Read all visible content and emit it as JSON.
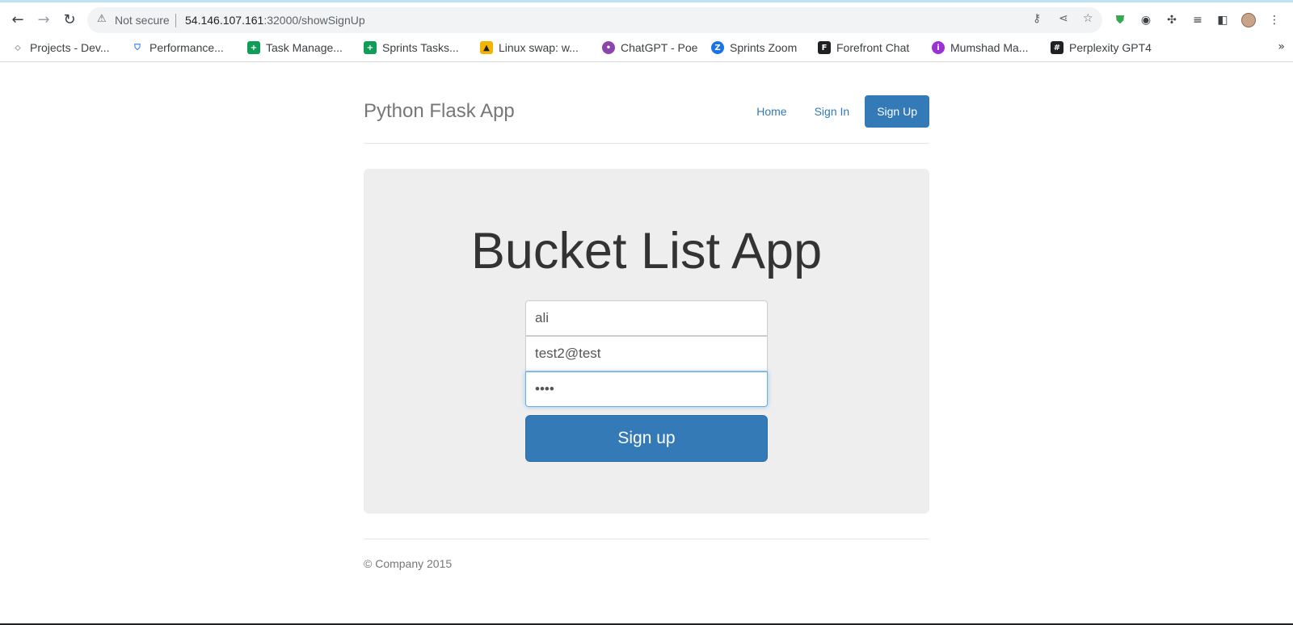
{
  "browser": {
    "omnibox": {
      "security_label": "Not secure",
      "url_host": "54.146.107.161",
      "url_rest": ":32000/showSignUp"
    },
    "bookmarks": [
      {
        "label": "Projects - Dev...",
        "icon_color": "#9aa0a6"
      },
      {
        "label": "Performance...",
        "icon_color": "#1a73e8"
      },
      {
        "label": "Task Manage...",
        "icon_color": "#0f9d58"
      },
      {
        "label": "Sprints Tasks...",
        "icon_color": "#0f9d58"
      },
      {
        "label": "Linux swap: w...",
        "icon_color": "#f4b400"
      },
      {
        "label": "ChatGPT - Poe",
        "icon_color": "#8e44ad"
      },
      {
        "label": "Sprints Zoom",
        "icon_color": "#1a73e8"
      },
      {
        "label": "Forefront Chat",
        "icon_color": "#202124"
      },
      {
        "label": "Mumshad Ma...",
        "icon_color": "#9b30d9"
      },
      {
        "label": "Perplexity GPT4",
        "icon_color": "#202124"
      }
    ],
    "more_bookmarks_glyph": "»"
  },
  "app": {
    "brand": "Python Flask App",
    "nav": {
      "home": "Home",
      "sign_in": "Sign In",
      "sign_up": "Sign Up"
    },
    "title": "Bucket List App",
    "form": {
      "name_value": "ali",
      "email_value": "test2@test",
      "password_value": "••••",
      "submit_label": "Sign up"
    },
    "footer": "© Company 2015"
  },
  "colors": {
    "primary": "#337ab7",
    "jumbotron_bg": "#eeeeee"
  }
}
